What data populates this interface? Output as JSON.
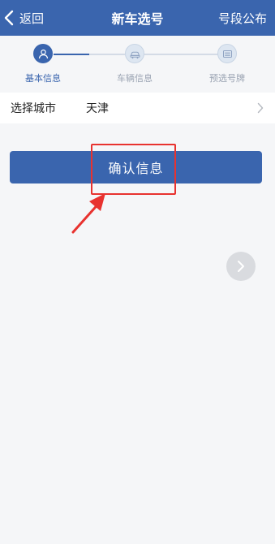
{
  "header": {
    "back_label": "返回",
    "title": "新车选号",
    "right_link": "号段公布"
  },
  "steps": [
    {
      "label": "基本信息",
      "state": "active",
      "icon": "user-icon"
    },
    {
      "label": "车辆信息",
      "state": "inactive",
      "icon": "car-icon"
    },
    {
      "label": "预选号牌",
      "state": "inactive",
      "icon": "plate-icon"
    }
  ],
  "city_row": {
    "label": "选择城市",
    "value": "天津",
    "icon": "chevron-right-icon"
  },
  "confirm_button": {
    "label": "确认信息"
  },
  "float_button": {
    "icon": "chevron-right-icon"
  },
  "colors": {
    "primary": "#3a65ae",
    "background": "#f5f6f8",
    "annotation": "#e8322f"
  }
}
